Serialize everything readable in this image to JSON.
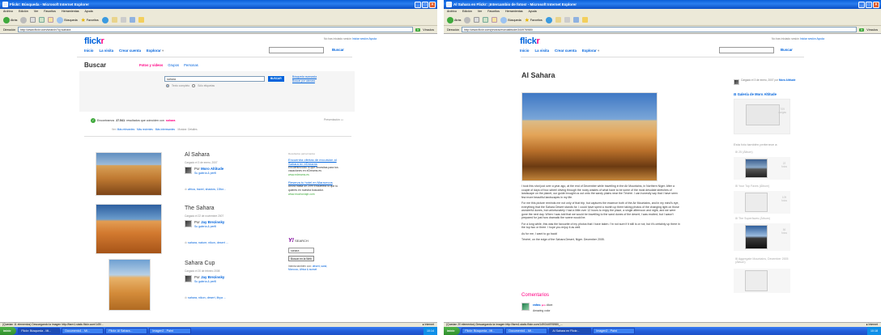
{
  "left": {
    "window_title": "Flickr: Búsqueda - Microsoft Internet Explorer",
    "menu": [
      "Archivo",
      "Edición",
      "Ver",
      "Favoritos",
      "Herramientas",
      "Ayuda"
    ],
    "toolbar": {
      "back": "Atrás",
      "search": "Búsqueda",
      "favorites": "Favoritos"
    },
    "address_label": "Dirección",
    "address": "http://www.flickr.com/search/?q=sahara",
    "go": "Ir",
    "links": "Vínculos",
    "signin": {
      "text": "No has iniciado sesión",
      "signin": "Iniciar sesión",
      "help": "Ayuda"
    },
    "nav": [
      "Inicio",
      "La visita",
      "Crear cuenta",
      "Explorar"
    ],
    "nav_search_btn": "Buscar",
    "page_title": "Buscar",
    "tabs": [
      "Fotos y videos",
      "Grupos",
      "Personas"
    ],
    "search_value": "sahara",
    "search_btn": "BUSCAR",
    "search_opts": [
      "Texto completo",
      "Sólo etiquetas"
    ],
    "advanced": [
      "Búsqueda avanzada",
      "Buscar por cámara"
    ],
    "results_prefix": "Encontramos",
    "results_count": "27.541",
    "results_suffix": "resultados que coinciden con",
    "results_query": "sahara",
    "sort": {
      "prefix": "Ver:",
      "relevant": "Más relevantes",
      "recent": "Más recientes",
      "interesting": "Más interesantes",
      "view": "Mostrar: Detalles"
    },
    "view_label": "Presentación",
    "results": [
      {
        "title": "Al Sahara",
        "meta": "Cargado el 3 de enero, 2007",
        "by": "Por",
        "owner": "Moro Altitude",
        "links": "Su galería & perfil",
        "tags": "africa, travel, shadow, 15for..."
      },
      {
        "title": "The Sahara",
        "meta": "Cargado el 22 de noviembre 2007",
        "by": "Por",
        "owner": "Jay Brezinsky",
        "links": "Su galería & perfil",
        "tags": "sahara, nature, nikon, desert ..."
      },
      {
        "title": "Sahara Cup",
        "meta": "Cargado el 20 de febrero 2008",
        "by": "Por",
        "owner": "Jay Brezinsky",
        "links": "Su galería & perfil",
        "tags": "sahara, nikon, desert, libya ..."
      }
    ],
    "ads": {
      "header": "Resultados patrocinados",
      "items": [
        {
          "title": "Encuentra ofertas de excursión al Sahara en eDreams",
          "body": "Encuentra todo lo que necesitas para tus vacaciones en eDreams.es",
          "url": "www.edreams.es"
        },
        {
          "title": "Reserva tu hotel en Marruecos",
          "body": "Ahora hasta un 20% Encuentra lo que tú quieres en nuestra buscador.",
          "url": "www.muchoviaje.com"
        }
      ]
    },
    "yahoo": {
      "logo": "Y!",
      "label": "SEARCH",
      "value": "sahara",
      "btn": "Buscar en la Web",
      "note": "Intenta también con:",
      "also": "desert, sand, Morocco, Africa & sunset"
    },
    "status": "(Quedan 11 elementos) Descargando la imagen http://farm1.static.flickr.com/149/...",
    "status_zone": "Internet",
    "taskbar": {
      "start": "inicio",
      "tasks": [
        "Flickr: Búsqueda - Mi...",
        "Documento1 - Mi...",
        "Flickr: Al Sahara...",
        "Imagen2 - Paint"
      ],
      "clock": "10:14"
    }
  },
  "right": {
    "window_title": "Al Sahara en Flickr: ¡Intercambio de fotos! - Microsoft Internet Explorer",
    "menu": [
      "Archivo",
      "Edición",
      "Ver",
      "Favoritos",
      "Herramientas",
      "Ayuda"
    ],
    "toolbar": {
      "back": "Atrás",
      "search": "Búsqueda",
      "favorites": "Favoritos"
    },
    "address_label": "Dirección",
    "address": "http://www.flickr.com/photos/moroaltitude/344976980/",
    "go": "Ir",
    "links": "Vínculos",
    "signin": {
      "text": "No has iniciado sesión",
      "signin": "Iniciar sesión",
      "help": "Ayuda"
    },
    "nav": [
      "Inicio",
      "La visita",
      "Crear cuenta",
      "Explorar"
    ],
    "nav_search_btn": "Buscar",
    "photo_title": "Al Sahara",
    "description": [
      "I took this shot just over a year ago, at the end of December while travelling in the Air Mountains, in Northern Niger. After a couple of days of four-wheel driving through the rocky wastes of what have to be some of the most desolate stretches of landscape on the planet, our guide brought us out onto the sandy plains near the Ténéré. I can honestly say that I have seen few more beautiful landscapes in my life.",
      "For me this picture reminds me not only of that trip, but captures the essence both of the Air Mountains, and in my mind's eye, everything that the Sahara Desert stands for. I could have spent a month up there taking photos of the changing light on those wonderful dunes, but unfortunately I had a little over 12 hours to enjoy the place, a single afternoon and night, and we were gone the next day. When I was told that we would be travelling to the sand dunes of the desert, I was excited, but I wasn't prepared for just how dramatic the scene would be.",
      "For a long while, this was the favourite of my photos that I have taken. I'm not sure if it still is or not, but it's certainly up there in the top two or three. I hope you enjoy it as well.",
      "As for me, I want to go back!",
      "Ténéré, on the edge of the Sahara Desert, Niger. December 2005."
    ],
    "comments_header": "Comentarios",
    "comment": {
      "author": "rafas",
      "badge": "pro",
      "says": "dice:",
      "text": "Amazing color"
    },
    "uploaded": {
      "text": "Cargado el 3 de enero, 2007",
      "by": "por",
      "owner": "Moro Altitude"
    },
    "gallery_header": "Galería de Moro Altitude",
    "gallery_count": "709",
    "gallery_count_label": "cargas",
    "sets_header": "Esta foto también pertenece a:",
    "sets": [
      {
        "label": "25 (Álbum)",
        "count": "22",
        "unit": "fotos"
      },
      {
        "label": "Your Top Faves (Álbum)",
        "count": "109",
        "unit": "fotos"
      },
      {
        "label": "The Superfaves (Álbum)",
        "count": "56",
        "unit": "fotos"
      },
      {
        "label": "Aggregate Mountains, December 2005 (Álbum)",
        "count": "",
        "unit": ""
      }
    ],
    "status": "(Quedan 20 elementos) Descargando la imagen http://farm1.static.flickr.com/149/344976980_...",
    "status_zone": "Internet",
    "taskbar": {
      "start": "inicio",
      "tasks": [
        "Flickr: Búsqueda - Mi...",
        "Documento1 - Mi...",
        "Al Sahara en Flickr...",
        "Imagen2 - Paint"
      ],
      "clock": "10:18"
    }
  },
  "colors": {
    "flickr_blue": "#0063dc",
    "flickr_pink": "#ff0084",
    "xp_blue": "#245edb",
    "xp_green": "#3fa93c"
  }
}
